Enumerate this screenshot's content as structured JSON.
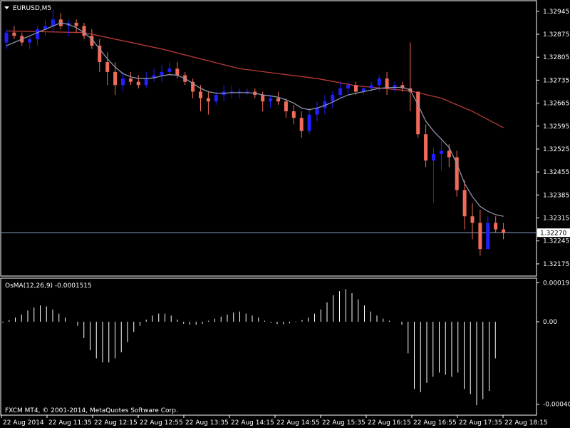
{
  "symbol_title": "EURUSD,M5",
  "indicator_title": "OsMA(12,26,9) -0.0001515",
  "copyright": "FXCM MT4, © 2001-2014, MetaQuotes Software Corp.",
  "current_price_label": "1.32270",
  "colors": {
    "background": "#000000",
    "bull": "#1f1fff",
    "bear": "#f26b5a",
    "ma_fast": "#8c95a8",
    "ma_slow": "#b83a38",
    "osma": "#ffffff",
    "price_line": "#8ea4c8",
    "frame": "#ffffff"
  },
  "chart_data": [
    {
      "type": "candlestick",
      "title": "EURUSD,M5",
      "ylim": [
        1.3214,
        1.32975
      ],
      "price_ticks": [
        "1.32945",
        "1.32875",
        "1.32805",
        "1.32735",
        "1.32665",
        "1.32595",
        "1.32525",
        "1.32455",
        "1.32385",
        "1.32315",
        "1.32245",
        "1.32175"
      ],
      "time_labels": [
        "22 Aug 2014",
        "22 Aug 11:35",
        "22 Aug 12:15",
        "22 Aug 12:55",
        "22 Aug 13:35",
        "22 Aug 14:15",
        "22 Aug 14:55",
        "22 Aug 15:35",
        "22 Aug 16:15",
        "22 Aug 16:55",
        "22 Aug 17:35",
        "22 Aug 18:15"
      ],
      "current_price": 1.3227,
      "candles": [
        [
          1.3285,
          1.3289,
          1.3283,
          1.3288
        ],
        [
          1.3288,
          1.329,
          1.3286,
          1.3287
        ],
        [
          1.3287,
          1.3288,
          1.3284,
          1.3285
        ],
        [
          1.3285,
          1.3287,
          1.3283,
          1.3286
        ],
        [
          1.3286,
          1.329,
          1.3284,
          1.3289
        ],
        [
          1.3289,
          1.3292,
          1.3287,
          1.329
        ],
        [
          1.329,
          1.3295,
          1.3288,
          1.3292
        ],
        [
          1.3292,
          1.3294,
          1.3289,
          1.329
        ],
        [
          1.329,
          1.3292,
          1.3287,
          1.3291
        ],
        [
          1.3291,
          1.3292,
          1.3288,
          1.329
        ],
        [
          1.329,
          1.3291,
          1.3286,
          1.3287
        ],
        [
          1.3287,
          1.3289,
          1.3283,
          1.3284
        ],
        [
          1.3284,
          1.3286,
          1.3276,
          1.3279
        ],
        [
          1.3279,
          1.3282,
          1.3272,
          1.3276
        ],
        [
          1.3276,
          1.3279,
          1.3269,
          1.3272
        ],
        [
          1.3272,
          1.3276,
          1.327,
          1.3274
        ],
        [
          1.3274,
          1.3276,
          1.3272,
          1.3273
        ],
        [
          1.3273,
          1.3275,
          1.3271,
          1.3272
        ],
        [
          1.3272,
          1.3276,
          1.3271,
          1.3274
        ],
        [
          1.3274,
          1.3277,
          1.3273,
          1.3275
        ],
        [
          1.3275,
          1.3278,
          1.3273,
          1.3276
        ],
        [
          1.3276,
          1.3279,
          1.3275,
          1.3277
        ],
        [
          1.3277,
          1.3279,
          1.3274,
          1.3275
        ],
        [
          1.3275,
          1.3276,
          1.3272,
          1.3273
        ],
        [
          1.3273,
          1.3274,
          1.3268,
          1.327
        ],
        [
          1.327,
          1.3272,
          1.3264,
          1.3268
        ],
        [
          1.3268,
          1.327,
          1.3263,
          1.3267
        ],
        [
          1.3267,
          1.327,
          1.3266,
          1.3269
        ],
        [
          1.3269,
          1.3272,
          1.3267,
          1.327
        ],
        [
          1.327,
          1.3272,
          1.3268,
          1.327
        ],
        [
          1.327,
          1.3271,
          1.3268,
          1.327
        ],
        [
          1.327,
          1.3271,
          1.3269,
          1.327
        ],
        [
          1.327,
          1.3271,
          1.3268,
          1.3269
        ],
        [
          1.3269,
          1.327,
          1.3264,
          1.3267
        ],
        [
          1.3267,
          1.3269,
          1.3265,
          1.3268
        ],
        [
          1.3268,
          1.327,
          1.3266,
          1.3267
        ],
        [
          1.3267,
          1.3268,
          1.3262,
          1.3264
        ],
        [
          1.3264,
          1.3266,
          1.326,
          1.3262
        ],
        [
          1.3262,
          1.3264,
          1.3256,
          1.3258
        ],
        [
          1.3258,
          1.3265,
          1.3257,
          1.3263
        ],
        [
          1.3263,
          1.3267,
          1.3261,
          1.3265
        ],
        [
          1.3265,
          1.3269,
          1.3263,
          1.3267
        ],
        [
          1.3267,
          1.327,
          1.3265,
          1.3269
        ],
        [
          1.3269,
          1.3273,
          1.3268,
          1.3271
        ],
        [
          1.3271,
          1.3273,
          1.3269,
          1.3272
        ],
        [
          1.3272,
          1.3273,
          1.3269,
          1.327
        ],
        [
          1.327,
          1.3272,
          1.3269,
          1.3271
        ],
        [
          1.3271,
          1.3273,
          1.327,
          1.3272
        ],
        [
          1.3272,
          1.3275,
          1.327,
          1.3274
        ],
        [
          1.3274,
          1.3276,
          1.3269,
          1.3271
        ],
        [
          1.3271,
          1.3273,
          1.327,
          1.3272
        ],
        [
          1.3272,
          1.3273,
          1.327,
          1.3271
        ],
        [
          1.3271,
          1.3285,
          1.3264,
          1.327
        ],
        [
          1.327,
          1.3268,
          1.3256,
          1.3257
        ],
        [
          1.3257,
          1.326,
          1.3247,
          1.3249
        ],
        [
          1.3249,
          1.3253,
          1.3236,
          1.3251
        ],
        [
          1.3251,
          1.3255,
          1.3246,
          1.3252
        ],
        [
          1.3252,
          1.3254,
          1.3247,
          1.325
        ],
        [
          1.325,
          1.3252,
          1.3238,
          1.324
        ],
        [
          1.324,
          1.3243,
          1.3228,
          1.3232
        ],
        [
          1.3232,
          1.3236,
          1.3225,
          1.323
        ],
        [
          1.323,
          1.3234,
          1.322,
          1.3222
        ],
        [
          1.3222,
          1.3232,
          1.3222,
          1.323
        ],
        [
          1.323,
          1.3232,
          1.3227,
          1.3228
        ],
        [
          1.3228,
          1.323,
          1.3225,
          1.3227
        ]
      ],
      "ma_fast": [
        1.3284,
        1.3285,
        1.3286,
        1.3287,
        1.3288,
        1.3289,
        1.329,
        1.3291,
        1.32905,
        1.32895,
        1.3288,
        1.3286,
        1.3283,
        1.328,
        1.32775,
        1.32755,
        1.32745,
        1.3274,
        1.3274,
        1.32742,
        1.32748,
        1.32752,
        1.3275,
        1.3274,
        1.32725,
        1.3271,
        1.327,
        1.32695,
        1.32695,
        1.32697,
        1.32697,
        1.32697,
        1.32695,
        1.3269,
        1.32687,
        1.32683,
        1.32675,
        1.32665,
        1.3265,
        1.32645,
        1.3265,
        1.32658,
        1.32668,
        1.3268,
        1.3269,
        1.32695,
        1.327,
        1.32705,
        1.3271,
        1.32712,
        1.32713,
        1.32713,
        1.32705,
        1.3266,
        1.3261,
        1.3258,
        1.32555,
        1.3253,
        1.3248,
        1.3242,
        1.3238,
        1.3235,
        1.32335,
        1.32325,
        1.3232
      ],
      "ma_slow_points": [
        [
          0,
          1.32885
        ],
        [
          10,
          1.3288
        ],
        [
          20,
          1.3283
        ],
        [
          30,
          1.3277
        ],
        [
          40,
          1.3274
        ],
        [
          45,
          1.32718
        ],
        [
          52,
          1.32702
        ],
        [
          56,
          1.3268
        ],
        [
          60,
          1.3264
        ],
        [
          64,
          1.3259
        ]
      ]
    },
    {
      "type": "bar",
      "title": "OsMA(12,26,9) -0.0001515",
      "ylim": [
        -0.000455,
        0.00021
      ],
      "tick_labels": [
        "0.0001910",
        "0.00",
        "-0.0004051"
      ],
      "tick_values": [
        0.000191,
        0.0,
        -0.0004051
      ],
      "values": [
        -5e-06,
        8e-06,
        2e-05,
        3.5e-05,
        5.5e-05,
        7e-05,
        8e-05,
        7.5e-05,
        6e-05,
        4e-05,
        2e-05,
        0.0,
        -2e-05,
        -8e-05,
        -0.00014,
        -0.00018,
        -0.0002,
        -0.0002,
        -0.00018,
        -0.00015,
        -0.0001,
        -5e-05,
        -2e-05,
        1e-05,
        3e-05,
        4e-05,
        4e-05,
        3e-05,
        1e-05,
        -1e-05,
        -1.5e-05,
        -1.5e-05,
        -1e-05,
        5e-06,
        1.5e-05,
        2.5e-05,
        3.5e-05,
        4.5e-05,
        5e-05,
        4e-05,
        3e-05,
        2e-05,
        5e-06,
        -5e-06,
        -1.2e-05,
        -1.2e-05,
        -8e-06,
        -3e-06,
        8e-06,
        2e-05,
        4e-05,
        6e-05,
        9.5e-05,
        0.00013,
        0.00015,
        0.00016,
        0.00014,
        0.00011,
        8e-05,
        5e-05,
        3e-05,
        1.5e-05,
        5e-06,
        0.0,
        -1.5e-05,
        -0.000155,
        -0.00033,
        -0.000345,
        -0.0003,
        -0.00027,
        -0.00025,
        -0.00026,
        -0.00027,
        -0.00025,
        -0.00033,
        -0.000355,
        -0.00041,
        -0.00038,
        -0.00034,
        -0.00018
      ]
    }
  ]
}
